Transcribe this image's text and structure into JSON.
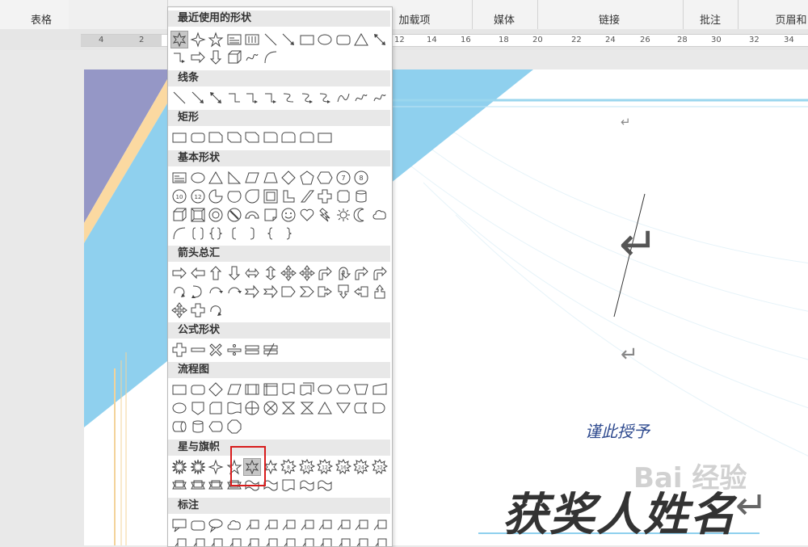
{
  "ribbon": {
    "groups": [
      "表格",
      "加载项",
      "媒体",
      "链接",
      "批注",
      "页眉和"
    ]
  },
  "ruler": {
    "left_numbers": [
      "4",
      "2"
    ],
    "right_numbers": [
      "12",
      "14",
      "16",
      "18",
      "20",
      "22",
      "24",
      "26",
      "28",
      "30",
      "32",
      "34"
    ]
  },
  "shapes_menu": {
    "categories": [
      "最近使用的形状",
      "线条",
      "矩形",
      "基本形状",
      "箭头总汇",
      "公式形状",
      "流程图",
      "星与旗帜",
      "标注"
    ],
    "selected_shape": "star-6-point",
    "badge_labels": [
      "7",
      "8",
      "10",
      "12",
      "16",
      "24",
      "32"
    ]
  },
  "document": {
    "award_text": "谨此授予",
    "name_text": "获奖人姓名",
    "paragraph_mark": "↵",
    "accent_color": "#8fd0ee",
    "purple_color": "#9597c6",
    "cream_color": "#fbd9a1"
  },
  "watermark": "Bai 经验"
}
